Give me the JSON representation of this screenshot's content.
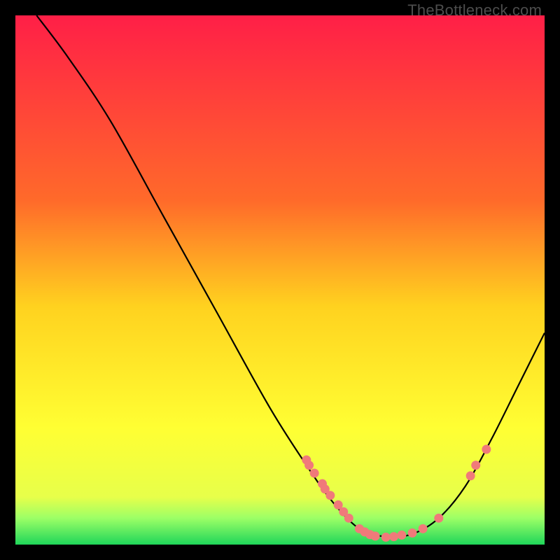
{
  "watermark": "TheBottleneck.com",
  "chart_data": {
    "type": "line",
    "title": "",
    "xlabel": "",
    "ylabel": "",
    "xlim": [
      0,
      100
    ],
    "ylim": [
      0,
      100
    ],
    "gradient_stops": [
      {
        "offset": 0,
        "color": "#ff1f47"
      },
      {
        "offset": 35,
        "color": "#ff6a2a"
      },
      {
        "offset": 55,
        "color": "#ffd21f"
      },
      {
        "offset": 78,
        "color": "#ffff33"
      },
      {
        "offset": 91,
        "color": "#e7ff4a"
      },
      {
        "offset": 95,
        "color": "#9cff66"
      },
      {
        "offset": 100,
        "color": "#1fd65a"
      }
    ],
    "curve": [
      {
        "x": 4,
        "y": 100
      },
      {
        "x": 10,
        "y": 92
      },
      {
        "x": 18,
        "y": 80
      },
      {
        "x": 28,
        "y": 62
      },
      {
        "x": 38,
        "y": 44
      },
      {
        "x": 48,
        "y": 26
      },
      {
        "x": 55,
        "y": 15
      },
      {
        "x": 60,
        "y": 8
      },
      {
        "x": 65,
        "y": 3
      },
      {
        "x": 70,
        "y": 1.5
      },
      {
        "x": 75,
        "y": 2
      },
      {
        "x": 80,
        "y": 5
      },
      {
        "x": 85,
        "y": 11
      },
      {
        "x": 90,
        "y": 20
      },
      {
        "x": 95,
        "y": 30
      },
      {
        "x": 100,
        "y": 40
      }
    ],
    "markers": [
      {
        "x": 55,
        "y": 16
      },
      {
        "x": 55.5,
        "y": 15
      },
      {
        "x": 56.5,
        "y": 13.5
      },
      {
        "x": 58,
        "y": 11.5
      },
      {
        "x": 58.5,
        "y": 10.5
      },
      {
        "x": 59.5,
        "y": 9.3
      },
      {
        "x": 61,
        "y": 7.5
      },
      {
        "x": 62,
        "y": 6.2
      },
      {
        "x": 63,
        "y": 5
      },
      {
        "x": 65,
        "y": 3
      },
      {
        "x": 66,
        "y": 2.4
      },
      {
        "x": 67,
        "y": 1.9
      },
      {
        "x": 68,
        "y": 1.6
      },
      {
        "x": 70,
        "y": 1.4
      },
      {
        "x": 71.5,
        "y": 1.5
      },
      {
        "x": 73,
        "y": 1.8
      },
      {
        "x": 75,
        "y": 2.2
      },
      {
        "x": 77,
        "y": 3
      },
      {
        "x": 80,
        "y": 5
      },
      {
        "x": 86,
        "y": 13
      },
      {
        "x": 87,
        "y": 15
      },
      {
        "x": 89,
        "y": 18
      }
    ],
    "marker_color": "#f07a7a",
    "curve_color": "#000000"
  }
}
